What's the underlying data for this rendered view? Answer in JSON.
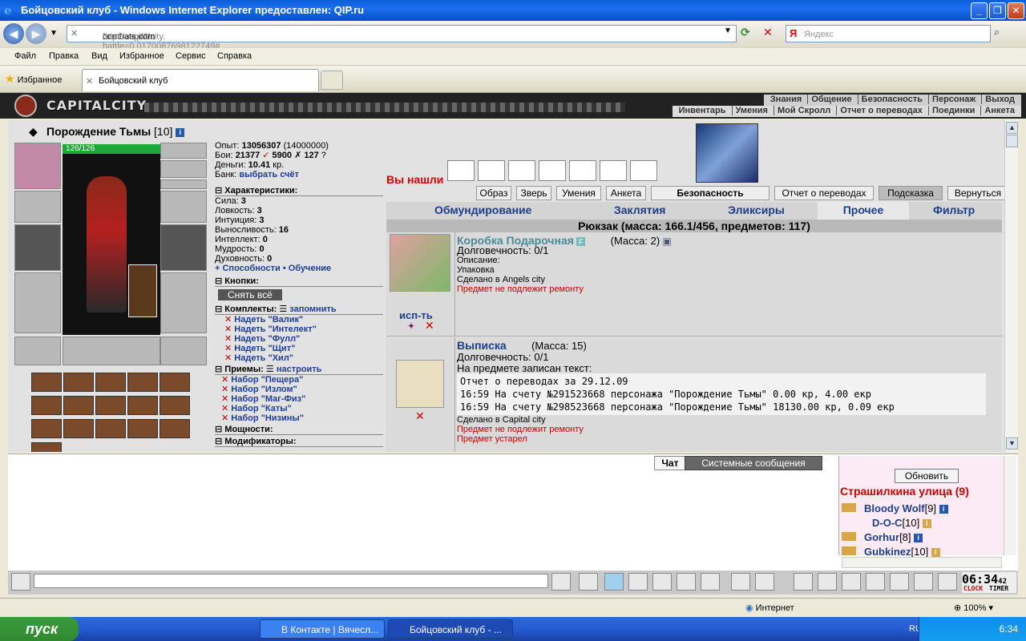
{
  "window": {
    "title": "Бойцовский клуб - Windows Internet Explorer предоставлен: QIP.ru",
    "minimize": "_",
    "maximize": "❐",
    "close": "✕"
  },
  "address": {
    "url_prefix": "http://capitalcity.",
    "url_domain": "combats.com",
    "url_suffix": "/buttons.pl?battle=0.0170087698122749#",
    "search_engine": "Я",
    "search_placeholder": "Яндекс"
  },
  "menu": [
    "Файл",
    "Правка",
    "Вид",
    "Избранное",
    "Сервис",
    "Справка"
  ],
  "favorites_label": "Избранное",
  "tab_title": "Бойцовский клуб",
  "game": {
    "logo": "CAPITALCITY",
    "nav_top": [
      "Знания",
      "Общение",
      "Безопасность",
      "Персонаж",
      "Выход"
    ],
    "nav_bottom": [
      "Инвентарь",
      "Умения",
      "Мой Скролл",
      "Отчет о переводах",
      "Поединки",
      "Анкета"
    ]
  },
  "character": {
    "name": "Порождение Тьмы",
    "level": "[10]",
    "hp": "126/126",
    "exp_label": "Опыт:",
    "exp": "13056307",
    "exp_next": "(14000000)",
    "battles_label": "Бои:",
    "wins": "21377",
    "losses": "5900",
    "draws": "127",
    "money_label": "Деньги:",
    "money": "10.41",
    "money_unit": "кр.",
    "bank_label": "Банк:",
    "bank_link": "выбрать счёт",
    "chars_head": "Характеристики:",
    "stats": [
      {
        "label": "Сила:",
        "value": "3"
      },
      {
        "label": "Ловкость:",
        "value": "3"
      },
      {
        "label": "Интуиция:",
        "value": "3"
      },
      {
        "label": "Выносливость:",
        "value": "16"
      },
      {
        "label": "Интеллект:",
        "value": "0"
      },
      {
        "label": "Мудрость:",
        "value": "0"
      },
      {
        "label": "Духовность:",
        "value": "0"
      }
    ],
    "abilities": "+ Способности",
    "training": "• Обучение",
    "buttons_head": "Кнопки:",
    "remove_all": "Снять всё",
    "sets_head": "Комплекты:",
    "remember": "запомнить",
    "sets": [
      "Надеть \"Валик\"",
      "Надеть \"Интелект\"",
      "Надеть \"Фулл\"",
      "Надеть \"Щит\"",
      "Надеть \"Хил\""
    ],
    "tricks_head": "Приемы:",
    "configure": "настроить",
    "trick_sets": [
      "Набор \"Пещера\"",
      "Набор \"Излом\"",
      "Набор \"Маг-Физ\"",
      "Набор \"Каты\"",
      "Набор \"Низины\""
    ],
    "power_head": "Мощности:",
    "mods_head": "Модификаторы:"
  },
  "inventory": {
    "found": "Вы нашли",
    "subtabs": [
      "Образ",
      "Зверь",
      "Умения",
      "Анкета",
      "Безопасность",
      "Отчет о переводах",
      "Подсказка",
      "Вернуться"
    ],
    "sections": [
      "Обмундирование",
      "Заклятия",
      "Эликсиры",
      "Прочее",
      "Фильтр"
    ],
    "backpack": "Рюкзак (масса: 166.1/456, предметов: 117)",
    "use_label": "исп-ть",
    "items": [
      {
        "name": "Коробка Подарочная",
        "mass": "(Масса: 2)",
        "durability": "Долговечность: 0/1",
        "desc_label": "Описание:",
        "desc": "Упаковка",
        "made": "Сделано в Angels city",
        "repair": "Предмет не подлежит ремонту"
      },
      {
        "name": "Выписка",
        "mass": "(Масса: 15)",
        "durability": "Долговечность: 0/1",
        "note_label": "На предмете записан текст:",
        "lines": [
          "Отчет о переводах за 29.12.09",
          "16:59 На счету №291523668 персонажа \"Порождение Тьмы\" 0.00 кр, 4.00 екр",
          "16:59 На счету №298523668 персонажа \"Порождение Тьмы\" 18130.00 кр, 0.09 екр"
        ],
        "made": "Сделано в Capital city",
        "repair": "Предмет не подлежит ремонту",
        "expired": "Предмет устарел"
      }
    ]
  },
  "chat": {
    "tab_chat": "Чат",
    "tab_system": "Системные сообщения",
    "refresh": "Обновить",
    "street": "Страшилкина улица (9)",
    "users": [
      {
        "name": "Bloody Wolf",
        "level": "[9]"
      },
      {
        "name": "D-O-C",
        "level": "[10]"
      },
      {
        "name": "Gorhur",
        "level": "[8]"
      },
      {
        "name": "Gubkinez",
        "level": "[10]"
      }
    ]
  },
  "clock": {
    "time": "06:34",
    "sec": "42",
    "clock_label": "CLOCK",
    "timer_label": "TIMER"
  },
  "statusbar": {
    "zone": "Интернет",
    "zoom": "100%"
  },
  "taskbar": {
    "start": "пуск",
    "tasks": [
      "В Контакте | Вячесл...",
      "Бойцовский клуб - ..."
    ],
    "lang": "RU",
    "time": "6:34"
  }
}
